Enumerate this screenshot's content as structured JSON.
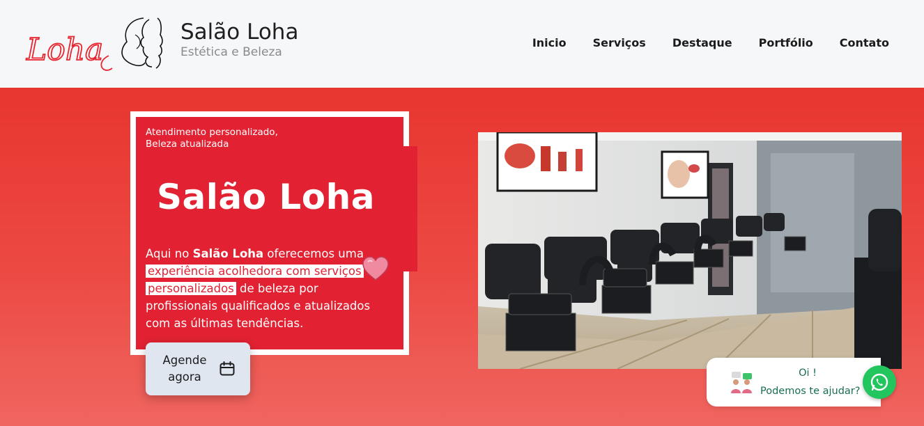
{
  "header": {
    "logo_text": "Loha",
    "brand_title": "Salão Loha",
    "brand_subtitle": "Estética e Beleza"
  },
  "nav": {
    "items": [
      {
        "label": "Inicio"
      },
      {
        "label": "Serviços"
      },
      {
        "label": "Destaque"
      },
      {
        "label": "Portfólio"
      },
      {
        "label": "Contato"
      }
    ]
  },
  "hero": {
    "tagline_line1": "Atendimento personalizado,",
    "tagline_line2": "Beleza atualizada",
    "title": "Salão Loha",
    "desc_part1": "Aqui no ",
    "desc_bold": "Salão Loha",
    "desc_part2": " oferecemos uma ",
    "desc_highlight1": "experiência acolhedora com serviços",
    "desc_highlight2": "personalizados",
    "desc_part3": " de beleza por profissionais qualificados e atualizados com as últimas tendências.",
    "cta_label": "Agende agora",
    "cta_icon": "calendar-icon",
    "heart_icon": "heart-icon",
    "photo_subject": "salon-interior-image"
  },
  "chat": {
    "line1": "Oi !",
    "line2": "Podemos te ajudar?",
    "avatar_icon": "support-people-icon",
    "whatsapp_icon": "whatsapp-icon"
  },
  "colors": {
    "brand_red": "#e22232",
    "hero_bg": "#e8352f",
    "whatsapp_green": "#22c55e",
    "chat_text": "#1a6d53"
  }
}
